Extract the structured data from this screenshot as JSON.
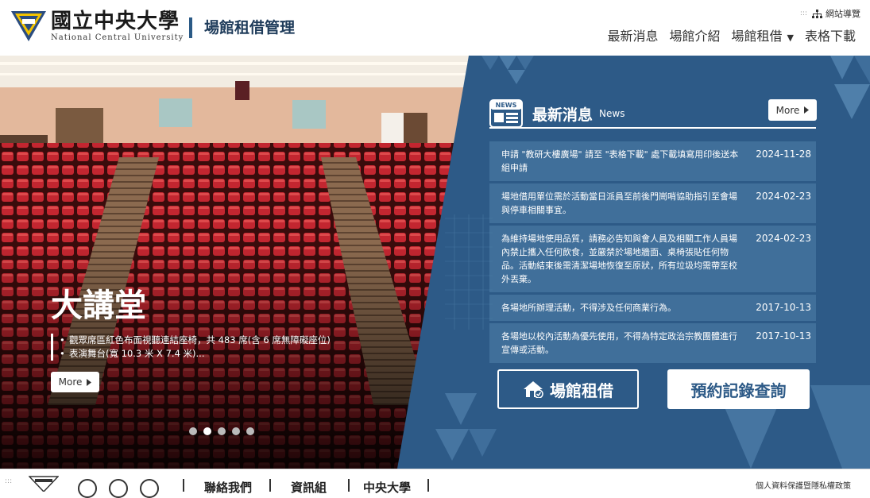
{
  "header": {
    "university_cn": "國立中央大學",
    "university_en": "National Central University",
    "site_name": "場館租借管理",
    "accesskey": ":::",
    "sitemap_label": "網站導覽",
    "nav": [
      {
        "label": "最新消息"
      },
      {
        "label": "場館介紹"
      },
      {
        "label": "場館租借"
      },
      {
        "label": "表格下載"
      }
    ]
  },
  "hero": {
    "title": "大講堂",
    "bullets": [
      "觀眾席區紅色布面視聽連結座椅，共 483 席(含 6 席無障礙座位)",
      "表演舞台(寬 10.3 米 X 7.4 米)..."
    ],
    "more_label": "More",
    "slide_count": 5,
    "active_slide": 2
  },
  "news": {
    "icon_text": "NEWS",
    "title": "最新消息",
    "subtitle": "News",
    "more_label": "More",
    "items": [
      {
        "text": "申請 \"教研大樓廣場\" 請至 \"表格下載\" 處下載填寫用印後送本組申請",
        "date": "2024-11-28"
      },
      {
        "text": "場地借用單位需於活動當日派員至前後門崗哨協助指引至會場與停車相關事宜。",
        "date": "2024-02-23"
      },
      {
        "text": "為維持場地使用品質，請務必告知與會人員及相關工作人員場內禁止攜入任何飲食，並嚴禁於場地牆面、桌椅張貼任何物品。活動結束後需清潔場地恢復至原狀，所有垃圾均需帶至校外丟棄。",
        "date": "2024-02-23"
      },
      {
        "text": "各場地所辦理活動，不得涉及任何商業行為。",
        "date": "2017-10-13"
      },
      {
        "text": "各場地以校內活動為優先使用，不得為特定政治宗教團體進行宣傳或活動。",
        "date": "2017-10-13"
      }
    ]
  },
  "actions": {
    "rent_label": "場館租借",
    "query_label": "預約記錄查詢"
  },
  "footer": {
    "accesskey": ":::",
    "links": [
      "聯絡我們",
      "資訊組",
      "中央大學"
    ],
    "privacy": "個人資料保護暨隱私權政策"
  },
  "colors": {
    "brand_blue": "#2d5a87",
    "seat_red": "#b3202a"
  }
}
